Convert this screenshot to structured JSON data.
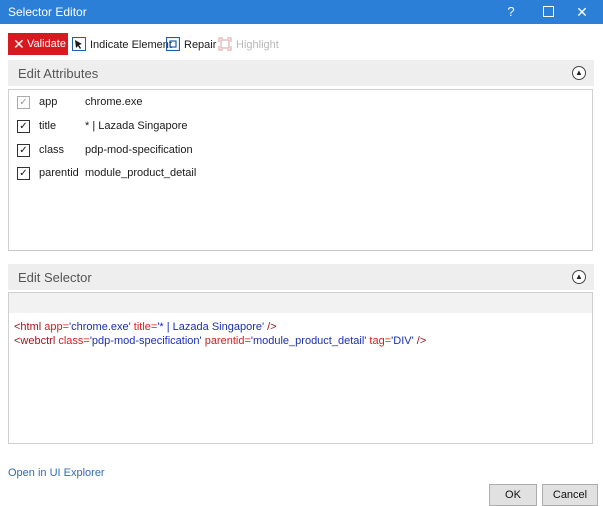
{
  "window": {
    "title": "Selector Editor",
    "help_label": "?",
    "close_label": "✕"
  },
  "toolbar": {
    "validate_label": "Validate",
    "indicate_label": "Indicate Element",
    "repair_label": "Repair",
    "highlight_label": "Highlight"
  },
  "edit_attributes": {
    "header": "Edit Attributes",
    "rows": [
      {
        "name": "app",
        "value": "chrome.exe",
        "checked": true,
        "enabled": false
      },
      {
        "name": "title",
        "value": "* | Lazada Singapore",
        "checked": true,
        "enabled": true
      },
      {
        "name": "class",
        "value": "pdp-mod-specification",
        "checked": true,
        "enabled": true
      },
      {
        "name": "parentid",
        "value": "module_product_detail",
        "checked": true,
        "enabled": true
      }
    ]
  },
  "edit_selector": {
    "header": "Edit Selector",
    "line1": {
      "open": "<html ",
      "a1": "app=",
      "v1": "'chrome.exe'",
      "a2": " title=",
      "v2": "'* | Lazada Singapore'",
      "close": " />"
    },
    "line2": {
      "open": "<webctrl ",
      "a1": "class=",
      "v1": "'pdp-mod-specification'",
      "a2": " parentid=",
      "v2": "'module_product_detail'",
      "a3": " tag=",
      "v3": "'DIV'",
      "close": " />"
    }
  },
  "footer": {
    "explorer_link": "Open in UI Explorer",
    "ok_label": "OK",
    "cancel_label": "Cancel"
  },
  "colors": {
    "titlebar": "#2b7fd7",
    "validate": "#d71920",
    "tag": "#a3151a",
    "attr_name": "#d0211b",
    "attr_value": "#1a2fb0"
  }
}
